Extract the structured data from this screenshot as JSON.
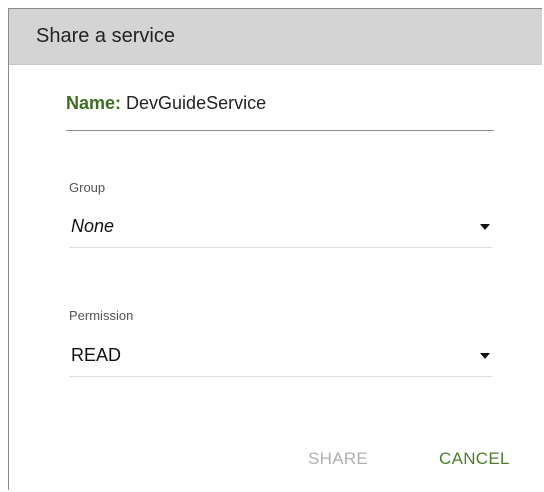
{
  "dialog": {
    "title": "Share a service"
  },
  "name": {
    "label": "Name:",
    "value": "DevGuideService"
  },
  "group": {
    "label": "Group",
    "selected": "None",
    "icon": "dropdown-caret-icon"
  },
  "permission": {
    "label": "Permission",
    "selected": "READ",
    "icon": "dropdown-caret-icon"
  },
  "actions": {
    "share_label": "SHARE",
    "cancel_label": "CANCEL"
  },
  "colors": {
    "header_bg": "#d4d4d4",
    "name_label": "#3c6e1f",
    "share_disabled": "#b0b0b0",
    "cancel_accent": "#4b7e2c"
  }
}
